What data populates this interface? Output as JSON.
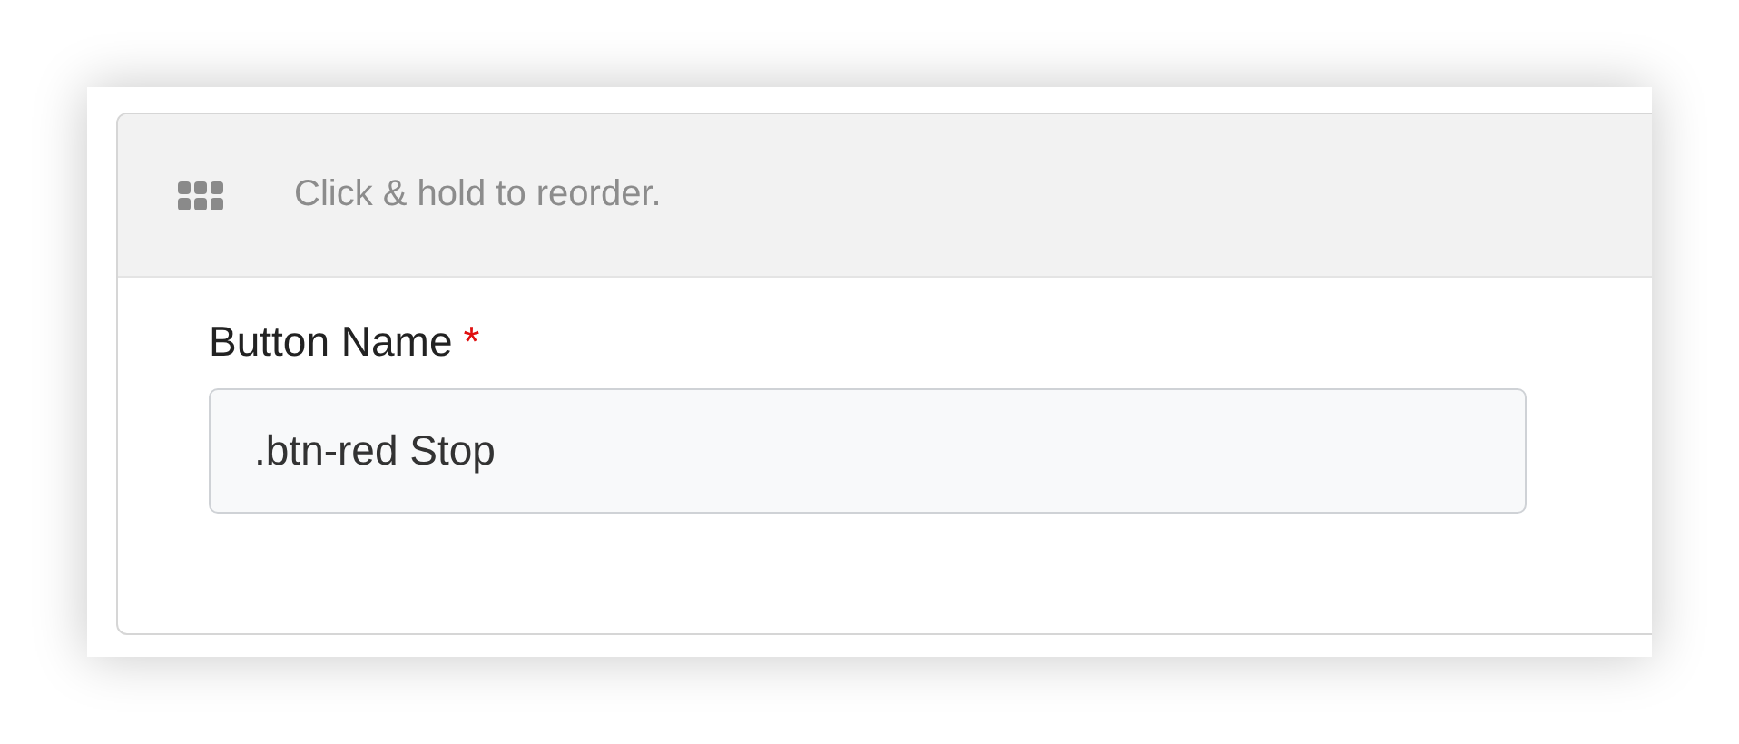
{
  "panel": {
    "drag_hint": "Click & hold to reorder."
  },
  "field": {
    "label": "Button Name",
    "required": true,
    "required_mark": "*",
    "value": ".btn-red Stop"
  }
}
